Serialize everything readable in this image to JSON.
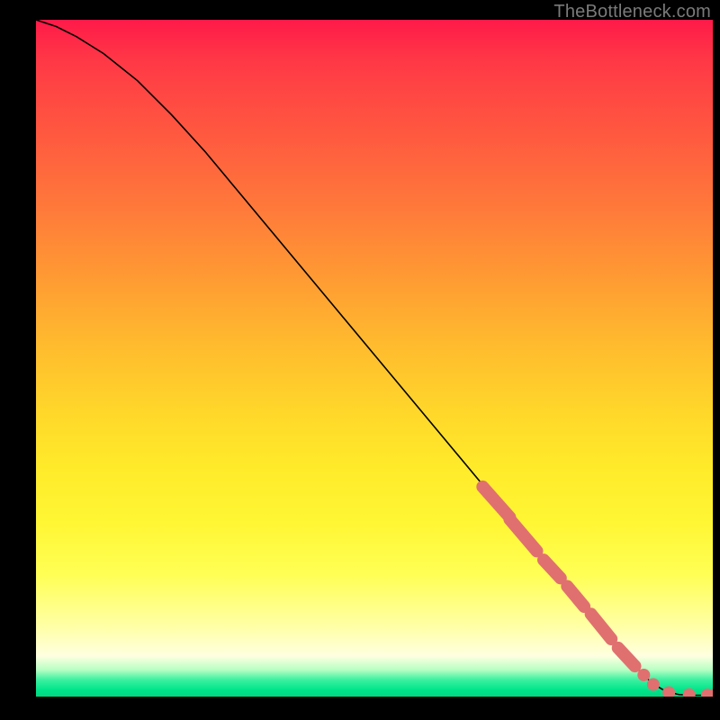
{
  "attribution": "TheBottleneck.com",
  "chart_data": {
    "type": "line",
    "title": "",
    "xlabel": "",
    "ylabel": "",
    "xlim": [
      0,
      100
    ],
    "ylim": [
      0,
      100
    ],
    "x": [
      0,
      3,
      6,
      10,
      15,
      20,
      25,
      30,
      35,
      40,
      45,
      50,
      55,
      60,
      65,
      70,
      75,
      80,
      85,
      88,
      91,
      93,
      95,
      97,
      100
    ],
    "y": [
      100,
      99,
      97.5,
      95,
      91,
      86,
      80.5,
      74.5,
      68.5,
      62.5,
      56.5,
      50.5,
      44.5,
      38.5,
      32.5,
      26.5,
      20.5,
      14.5,
      8.5,
      5,
      2,
      0.8,
      0.3,
      0.2,
      0.2
    ],
    "markers": {
      "segments": [
        {
          "x0": 66,
          "y0": 31,
          "x1": 70,
          "y1": 26.5
        },
        {
          "x0": 70,
          "y0": 26.2,
          "x1": 74,
          "y1": 21.5
        },
        {
          "x0": 75,
          "y0": 20.2,
          "x1": 77.5,
          "y1": 17.5
        },
        {
          "x0": 78.5,
          "y0": 16.3,
          "x1": 81,
          "y1": 13.3
        },
        {
          "x0": 82,
          "y0": 12.2,
          "x1": 85,
          "y1": 8.5
        },
        {
          "x0": 86,
          "y0": 7.2,
          "x1": 88.5,
          "y1": 4.5
        }
      ],
      "dots": [
        {
          "x": 89.8,
          "y": 3.2
        },
        {
          "x": 91.2,
          "y": 1.8
        },
        {
          "x": 93.5,
          "y": 0.6
        },
        {
          "x": 96.5,
          "y": 0.3
        },
        {
          "x": 99.2,
          "y": 0.25
        },
        {
          "x": 100.2,
          "y": 0.25
        }
      ],
      "radius": 7
    }
  }
}
